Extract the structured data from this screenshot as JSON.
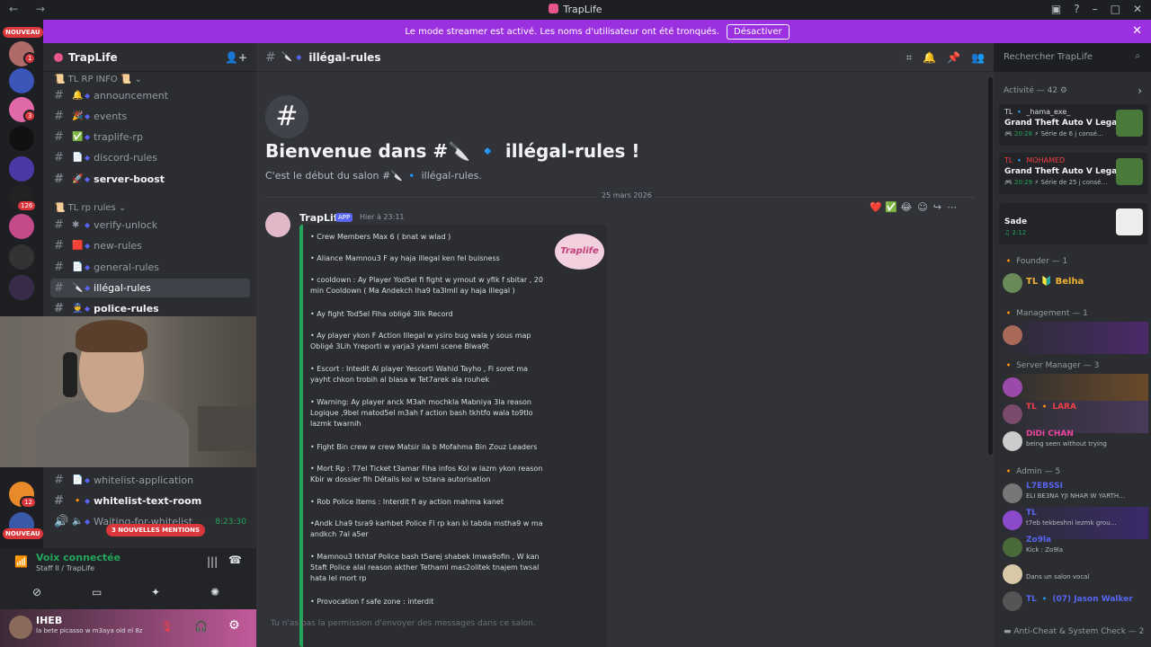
{
  "window": {
    "title": "TrapLife"
  },
  "banner": {
    "text": "Le mode streamer est activé. Les noms d'utilisateur ont été tronqués.",
    "button": "Désactiver"
  },
  "servers": {
    "nouveau": "NOUVEAU",
    "badges": [
      "1",
      "3",
      "126",
      "12"
    ]
  },
  "guild": {
    "name": "TrapLife"
  },
  "categories": [
    {
      "label": "TL RP INFO"
    },
    {
      "label": "TL rp rules"
    }
  ],
  "channels": [
    {
      "label": "announcement",
      "emoji": "🔔"
    },
    {
      "label": "events",
      "emoji": "🎉"
    },
    {
      "label": "traplife-rp",
      "emoji": "✅"
    },
    {
      "label": "discord-rules",
      "emoji": "📄"
    },
    {
      "label": "server-boost",
      "emoji": "🚀"
    },
    {
      "label": "verify-unlock",
      "emoji": "✱"
    },
    {
      "label": "new-rules",
      "emoji": "🟥"
    },
    {
      "label": "general-rules",
      "emoji": "📄"
    },
    {
      "label": "illégal-rules",
      "emoji": "🔪"
    },
    {
      "label": "police-rules",
      "emoji": "👮"
    },
    {
      "label": "whitelist-application",
      "emoji": "📄"
    },
    {
      "label": "whitelist-text-room",
      "emoji": "🔸"
    },
    {
      "label": "Waiting-for-whitelist",
      "emoji": "🔈",
      "time": "8:23:30"
    }
  ],
  "mentions": "3 NOUVELLES MENTIONS",
  "voice": {
    "status": "Voix connectée",
    "sub": "Staff II / TrapLife"
  },
  "user": {
    "name": "IHEB",
    "status": "la bete picasso w m3aya old el 8z"
  },
  "header": {
    "channel": "illégal-rules",
    "search_placeholder": "Rechercher TrapLife"
  },
  "welcome": {
    "title": "Bienvenue dans #🔪 🔹 illégal-rules !",
    "sub": "C'est le début du salon #🔪 🔹 illégal-rules.",
    "date": "25 mars 2026"
  },
  "message": {
    "author": "TrapLife",
    "tag": "APP",
    "time": "Hier à 23:11",
    "logo": "Traplife",
    "reactions": "❤️ ✅ 😂",
    "rules": [
      "• Crew Members Max 6 ( bnat w wlad )",
      "• Aliance Mamnou3 F ay haja illegal ken fel buisness",
      "• cooldown : Ay Player Yod5el fi fight w ymout w yfik f sbitar , 20 min Cooldown ( Ma Andekch lha9 ta3lmll ay haja illegal )",
      "• Ay fight Tod5el Fiha obligé 3lik Record",
      "• Ay player ykon F Action Illegal w ysiro bug wala y sous map Obligé 3Lih Yreporti w yarja3 ykaml scene Blwa9t",
      "• Escort : Intedit Al player Yescorti Wahid Tayho , Fi soret ma yayht chkon trobih al blasa w Tet7arek ala rouhek",
      "• Warning: Ay player anck M3ah mochkla Mabniya 3la reason Logique ,9bel matod5el m3ah f action bash tkhtfo wala to9tlo lazmk twarnih",
      "• Fight Bin crew w crew Matsir ila b Mofahma Bin Zouz Leaders",
      "• Mort Rp : T7el Ticket t3amar Fiha infos Kol w lazm ykon reason Kbir w dossier fih Détails kol w tstana autorisation",
      "• Rob Police Items : Interdit fi ay action mahma kanet",
      "•Andk Lha9 tsra9 karhbet Police Fl rp kan ki tabda mstha9 w ma andkch 7al a5er",
      "• Mamnou3 tkhtaf Police bash t5arej shabek lmwa9ofin , W kan 5taft Police alal reason akther Tethaml mas2olitek tnajem twsal hata lel mort rp",
      "• Provocation f safe zone : interdit"
    ]
  },
  "no_permission": "Tu n'as pas la permission d'envoyer des messages dans ce salon.",
  "members": {
    "activity_header": "Activité — 42",
    "activities": [
      {
        "name": "TL 🔹 _hama_exe_",
        "game": "Grand Theft Auto V Legacy",
        "time": "20:28",
        "detail": "Série de 6 j consé…",
        "color": "#dbdee1"
      },
      {
        "name": "TL 🔹 MOHAMED",
        "game": "Grand Theft Auto V Legacy",
        "time": "20:29",
        "detail": "Série de 25 j consé…",
        "color": "#f23f43"
      },
      {
        "name": "",
        "game": "Sade",
        "time": "2:12",
        "detail": "",
        "color": "#f23f43"
      }
    ],
    "groups": [
      {
        "header": "Founder — 1",
        "rows": [
          {
            "name": "TL 🔰 Belha",
            "status": "",
            "color": "#f0b232"
          }
        ]
      },
      {
        "header": "Management — 1",
        "rows": [
          {
            "name": "",
            "status": "",
            "color": "#f23f43"
          }
        ]
      },
      {
        "header": "Server Manager — 3",
        "rows": [
          {
            "name": "",
            "status": "",
            "color": "#eb459e"
          },
          {
            "name": "TL 🔸 LARA",
            "status": "",
            "color": "#f23f43"
          },
          {
            "name": "DiDi CHAN",
            "status": "being seen without trying",
            "color": "#eb459e"
          }
        ]
      },
      {
        "header": "Admin — 5",
        "rows": [
          {
            "name": "L7EBSSI",
            "status": "ELI BE3NA YJI NHAR W YARTH…",
            "color": "#5865f2"
          },
          {
            "name": "TL",
            "status": "t7eb tekbeshni lezmk grou…",
            "color": "#5865f2"
          },
          {
            "name": "Zo9la",
            "status": "Kick : Zo9la",
            "color": "#5865f2"
          },
          {
            "name": "",
            "status": "Dans un salon vocal",
            "color": "#5865f2"
          },
          {
            "name": "TL 🔹 (07) Jason Walker",
            "status": "",
            "color": "#5865f2"
          }
        ]
      },
      {
        "header": "Anti-Cheat & System Check — 2",
        "rows": []
      }
    ]
  }
}
